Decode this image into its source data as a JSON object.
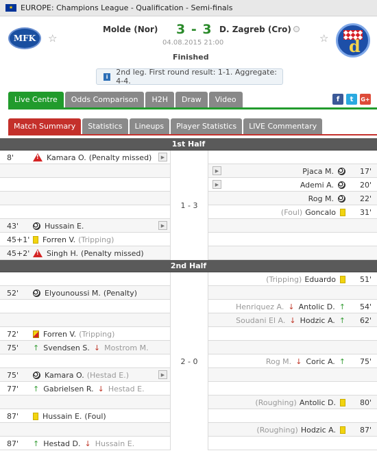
{
  "topbar": {
    "title": "EUROPE: Champions League - Qualification - Semi-finals",
    "flag_text": "★"
  },
  "match": {
    "home_team": "Molde (Nor)",
    "away_team": "D. Zagreb (Cro)",
    "score": "3 - 3",
    "datetime": "04.08.2015 21:00",
    "status": "Finished",
    "home_logo_text": "MFK",
    "away_logo_text": "d"
  },
  "notice": {
    "text": "2nd leg. First round result: 1-1. Aggregate: 4-4.",
    "icon": "i"
  },
  "tabs1": [
    "Live Centre",
    "Odds Comparison",
    "H2H",
    "Draw",
    "Video"
  ],
  "social": {
    "facebook": "f",
    "twitter": "t",
    "google": "G+"
  },
  "tabs2": [
    "Match Summary",
    "Statistics",
    "Lineups",
    "Player Statistics",
    "LIVE Commentary"
  ],
  "first_half": {
    "title": "1st Half",
    "score": "1 - 3",
    "rows": [
      {
        "side": "home",
        "time": "8'",
        "icon": "warning-icon",
        "player": "Kamara O.",
        "extra": "(Penalty missed)",
        "extra_class": "",
        "video": true
      },
      {
        "side": "away",
        "time": "17'",
        "icon": "ball-icon",
        "player": "Pjaca M.",
        "extra": "",
        "video": true
      },
      {
        "side": "away",
        "time": "20'",
        "icon": "ball-icon",
        "player": "Ademi A.",
        "extra": "",
        "video": true
      },
      {
        "side": "away",
        "time": "22'",
        "icon": "ball-icon",
        "player": "Rog M.",
        "extra": "",
        "video": false
      },
      {
        "side": "away",
        "time": "31'",
        "icon": "yellow-card-icon",
        "player": "Goncalo",
        "extra": "(Foul)",
        "video": false
      },
      {
        "side": "home",
        "time": "43'",
        "icon": "ball-icon",
        "player": "Hussain E.",
        "extra": "",
        "video": true
      },
      {
        "side": "home",
        "time": "45+1'",
        "icon": "yellow-card-icon",
        "player": "Forren V.",
        "extra": "(Tripping)",
        "video": false
      },
      {
        "side": "home",
        "time": "45+2'",
        "icon": "warning-icon",
        "player": "Singh H.",
        "extra": "(Penalty missed)",
        "extra_class": "",
        "video": false
      }
    ]
  },
  "second_half": {
    "title": "2nd Half",
    "score": "2 - 0",
    "rows": [
      {
        "side": "away",
        "time": "51'",
        "icon": "yellow-card-icon",
        "player": "Eduardo",
        "extra": "(Tripping)",
        "video": false
      },
      {
        "side": "home",
        "time": "52'",
        "icon": "ball-icon",
        "player": "Elyounoussi M.",
        "extra": "(Penalty)",
        "extra_class": "",
        "video": false
      },
      {
        "side": "away",
        "time": "54'",
        "icon": "sub",
        "player": "Antolic D.",
        "out": "Henriquez A.",
        "video": false
      },
      {
        "side": "away",
        "time": "62'",
        "icon": "sub",
        "player": "Hodzic A.",
        "out": "Soudani El A.",
        "video": false
      },
      {
        "side": "home",
        "time": "72'",
        "icon": "red-yellow-card-icon",
        "player": "Forren V.",
        "extra": "(Tripping)",
        "video": false
      },
      {
        "side": "home",
        "time": "75'",
        "icon": "sub",
        "player": "Svendsen S.",
        "out": "Mostrom M.",
        "video": false
      },
      {
        "side": "away",
        "time": "75'",
        "icon": "sub",
        "player": "Coric A.",
        "out": "Rog M.",
        "video": false
      },
      {
        "side": "home",
        "time": "75'",
        "icon": "ball-icon",
        "player": "Kamara O.",
        "extra": "(Hestad E.)",
        "video": true
      },
      {
        "side": "home",
        "time": "77'",
        "icon": "sub",
        "player": "Gabrielsen R.",
        "out": "Hestad E.",
        "video": false
      },
      {
        "side": "away",
        "time": "80'",
        "icon": "yellow-card-icon",
        "player": "Antolic D.",
        "extra": "(Roughing)",
        "video": false
      },
      {
        "side": "home",
        "time": "87'",
        "icon": "yellow-card-icon",
        "player": "Hussain E.",
        "extra": "(Foul)",
        "extra_class": "",
        "video": false
      },
      {
        "side": "away",
        "time": "87'",
        "icon": "yellow-card-icon",
        "player": "Hodzic A.",
        "extra": "(Roughing)",
        "video": false
      },
      {
        "side": "home",
        "time": "87'",
        "icon": "sub",
        "player": "Hestad D.",
        "out": "Hussain E.",
        "video": false
      }
    ]
  }
}
